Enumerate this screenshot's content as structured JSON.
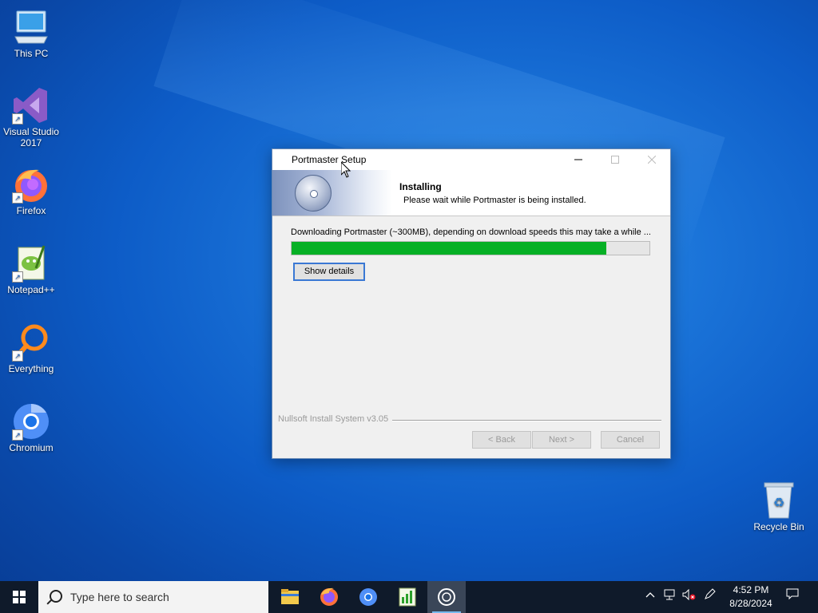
{
  "desktop": {
    "icons": [
      {
        "label": "This PC",
        "icon": "computer-icon"
      },
      {
        "label": "Visual Studio 2017",
        "icon": "visual-studio-icon"
      },
      {
        "label": "Firefox",
        "icon": "firefox-icon"
      },
      {
        "label": "Notepad++",
        "icon": "notepadpp-icon"
      },
      {
        "label": "Everything",
        "icon": "everything-search-icon"
      },
      {
        "label": "Chromium",
        "icon": "chromium-icon"
      }
    ],
    "recycle_bin": {
      "label": "Recycle Bin",
      "icon": "recycle-bin-icon"
    }
  },
  "window": {
    "title": "Portmaster Setup",
    "header_title": "Installing",
    "header_subtitle": "Please wait while Portmaster is being installed.",
    "status": "Downloading Portmaster (~300MB), depending on download speeds this may take a while ...",
    "progress": 0.88,
    "show_details_label": "Show details",
    "branding": "Nullsoft Install System v3.05",
    "back_label": "< Back",
    "next_label": "Next >",
    "cancel_label": "Cancel",
    "accent_color": "#06b025"
  },
  "taskbar": {
    "search_placeholder": "Type here to search",
    "apps": [
      "file-explorer-icon",
      "firefox-icon",
      "chromium-icon",
      "task-manager-icon",
      "portmaster-setup-icon"
    ],
    "clock_time": "4:52 PM",
    "clock_date": "8/28/2024"
  }
}
